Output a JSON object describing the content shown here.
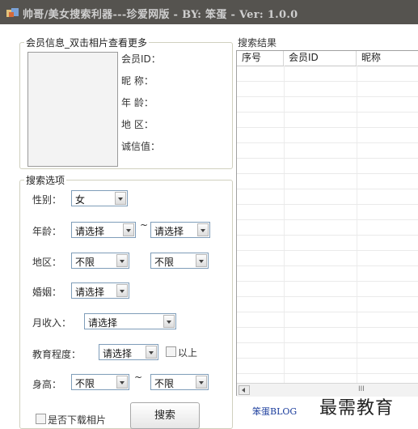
{
  "window": {
    "title": "帅哥/美女搜索利器---珍爱网版 - BY: 笨蛋 - Ver: 1.0.0"
  },
  "member_info": {
    "group_title": "会员信息_双击相片查看更多",
    "fields": [
      "会员ID：",
      "昵  称：",
      "年  龄：",
      "地  区：",
      "诚信值："
    ]
  },
  "search_options": {
    "group_title": "搜索选项",
    "gender_label": "性别：",
    "gender_value": "女",
    "age_label": "年龄：",
    "age_from": "请选择",
    "age_to": "请选择",
    "range_sep": "~",
    "region_label": "地区：",
    "region_province": "不限",
    "region_city": "不限",
    "marriage_label": "婚姻：",
    "marriage_value": "请选择",
    "income_label": "月收入：",
    "income_value": "请选择",
    "education_label": "教育程度：",
    "education_value": "请选择",
    "education_above_label": "以上",
    "height_label": "身高：",
    "height_from": "不限",
    "height_to": "不限",
    "download_photos_label": "是否下载相片",
    "search_button": "搜索"
  },
  "results": {
    "group_title": "搜索结果",
    "columns": [
      "序号",
      "会员ID",
      "昵称"
    ],
    "scroll_grip": "III"
  },
  "footer": {
    "blog_link": "笨蛋BLOG",
    "watermark": "最需教育"
  },
  "colors": {
    "titlebar": "#55534f",
    "window_bg": "#ffffff",
    "combo_border": "#7f9db9",
    "link": "#1a3c9c"
  },
  "icons": {
    "title_icon": "app-icon",
    "combo_arrow": "chevron-down-icon",
    "scroll_left": "arrow-left-icon"
  }
}
